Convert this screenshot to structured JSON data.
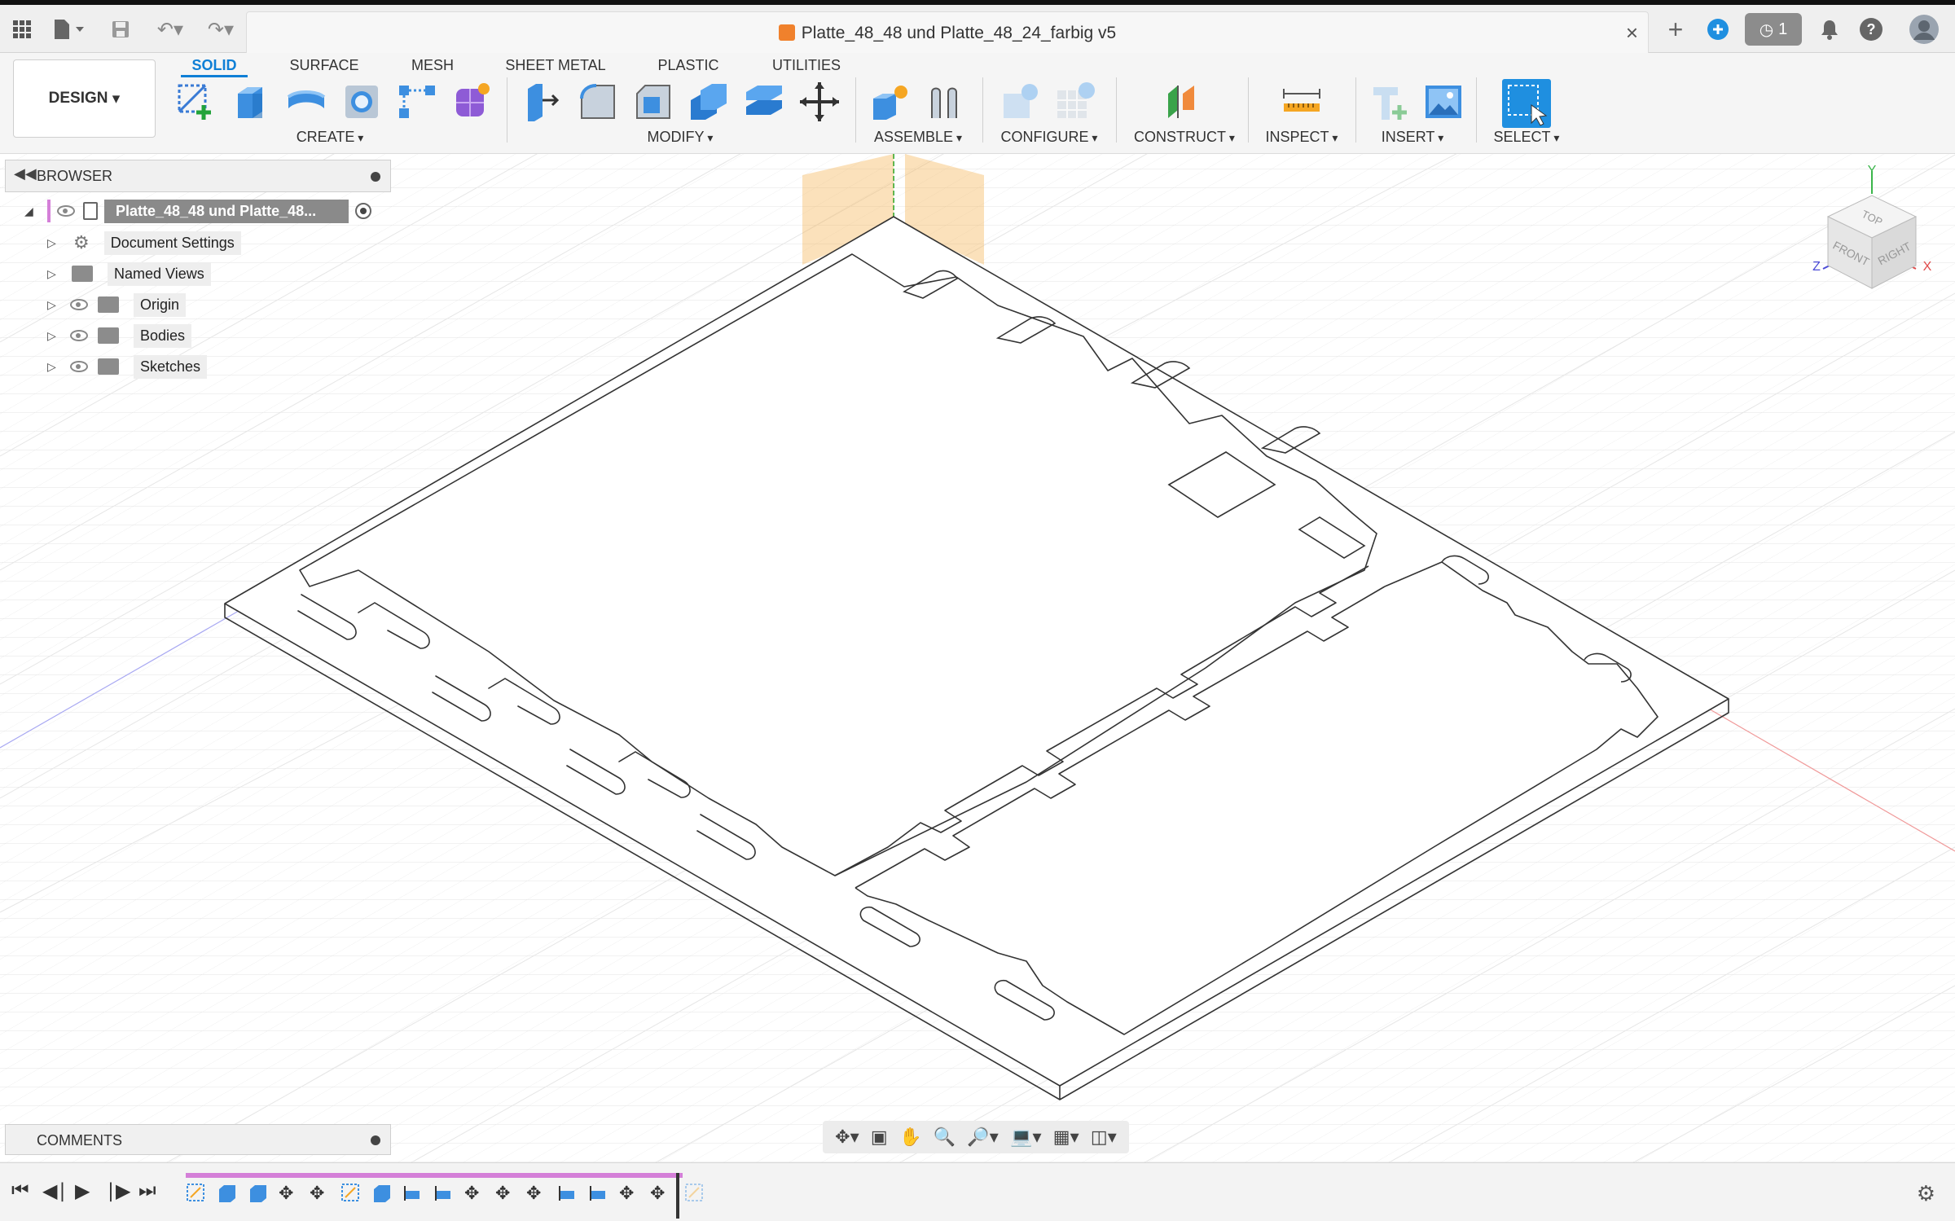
{
  "window": {
    "title": "Platte_48_48 und Platte_48_24_farbig v5",
    "close_glyph": "×",
    "job_count": "1"
  },
  "workspace": {
    "design_label": "DESIGN"
  },
  "tabs": [
    "SOLID",
    "SURFACE",
    "MESH",
    "SHEET METAL",
    "PLASTIC",
    "UTILITIES"
  ],
  "groups": {
    "create": "CREATE",
    "modify": "MODIFY",
    "assemble": "ASSEMBLE",
    "configure": "CONFIGURE",
    "construct": "CONSTRUCT",
    "inspect": "INSPECT",
    "insert": "INSERT",
    "select": "SELECT"
  },
  "browser": {
    "title": "BROWSER",
    "root": "Platte_48_48 und Platte_48...",
    "items": [
      "Document Settings",
      "Named Views",
      "Origin",
      "Bodies",
      "Sketches"
    ]
  },
  "viewcube": {
    "top": "TOP",
    "front": "FRONT",
    "right": "RIGHT",
    "x": "X",
    "y": "Y",
    "z": "Z"
  },
  "comments": {
    "title": "COMMENTS"
  },
  "colors": {
    "accent": "#0f7fd6",
    "timeline": "#d47fd8",
    "origin_plane": "#f6b556"
  }
}
